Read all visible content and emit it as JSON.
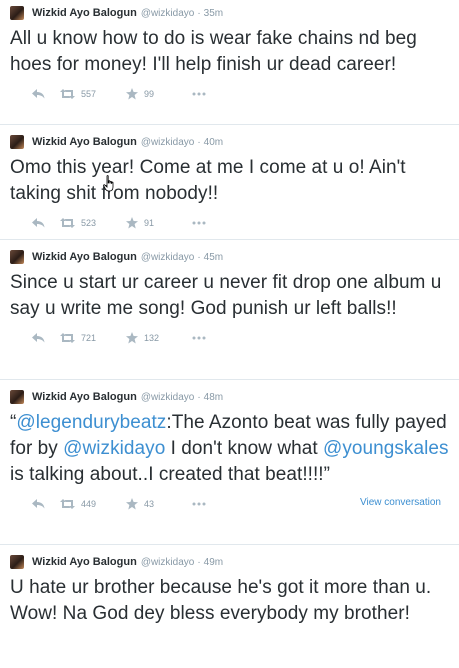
{
  "tweets": [
    {
      "name": "Wizkid Ayo Balogun",
      "handle": "@wizkidayo",
      "sep": "·",
      "time": "35m",
      "text": "All u know how to do is wear fake chains nd beg hoes for money! I'll help finish ur dead career!",
      "retweets": "557",
      "favorites": "99"
    },
    {
      "name": "Wizkid Ayo Balogun",
      "handle": "@wizkidayo",
      "sep": "·",
      "time": "40m",
      "text": "Omo this year! Come at me I come at u o! Ain't taking shit from nobody!!",
      "retweets": "523",
      "favorites": "91"
    },
    {
      "name": "Wizkid Ayo Balogun",
      "handle": "@wizkidayo",
      "sep": "·",
      "time": "45m",
      "text": "Since u start ur career u never fit drop one album u say u write me song! God punish ur left balls!!",
      "retweets": "721",
      "favorites": "132"
    },
    {
      "name": "Wizkid Ayo Balogun",
      "handle": "@wizkidayo",
      "sep": "·",
      "time": "48m",
      "text_parts": {
        "open_quote": "“",
        "mention1": "@legendurybeatz",
        "part1": ":The Azonto beat was fully payed for by ",
        "mention2": "@wizkidayo",
        "part2": " I don't know what ",
        "mention3": "@youngskales",
        "part3": " is talking about..I created that beat!!!!”"
      },
      "retweets": "449",
      "favorites": "43",
      "view_conversation": "View conversation"
    },
    {
      "name": "Wizkid Ayo Balogun",
      "handle": "@wizkidayo",
      "sep": "·",
      "time": "49m",
      "text": "U hate ur brother because he's got it more than u. Wow! Na God dey bless everybody my brother!"
    }
  ],
  "colors": {
    "link": "#3d8fd1",
    "text": "#292f33",
    "muted": "#8899a6",
    "divider": "#e1e8ed"
  },
  "icons": {
    "reply": "reply-icon",
    "retweet": "retweet-icon",
    "favorite": "star-icon",
    "more": "more-dots-icon",
    "cursor": "hand-cursor-icon"
  }
}
